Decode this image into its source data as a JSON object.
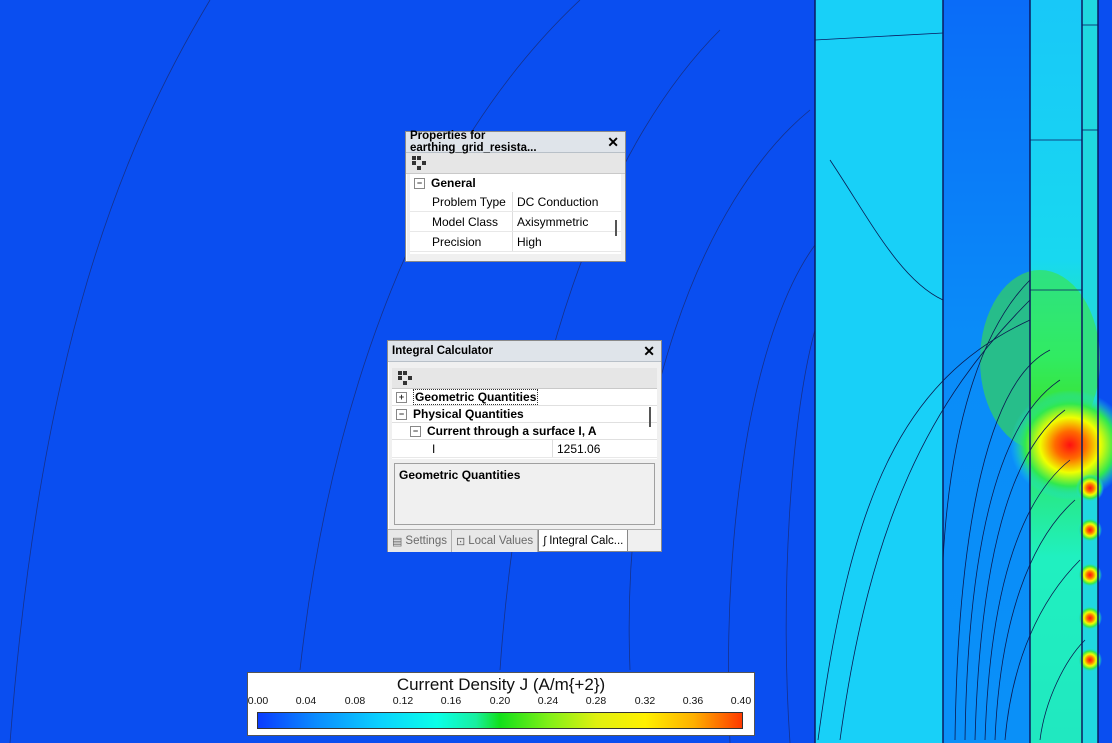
{
  "properties_window": {
    "title": "Properties for earthing_grid_resista...",
    "close_glyph": "✕",
    "group_label": "General",
    "rows": [
      {
        "key": "Problem Type",
        "value": "DC Conduction"
      },
      {
        "key": "Model Class",
        "value": "Axisymmetric"
      },
      {
        "key": "Precision",
        "value": "High"
      }
    ]
  },
  "integral_window": {
    "title": "Integral Calculator",
    "close_glyph": "✕",
    "groups": {
      "geometric": "Geometric Quantities",
      "physical": "Physical Quantities",
      "current": "Current through a surface I, A"
    },
    "value_row": {
      "key": "I",
      "value": "1251.06"
    },
    "description": "Geometric Quantities",
    "tabs": [
      {
        "label": "Settings",
        "active": false
      },
      {
        "label": "Local Values",
        "active": false
      },
      {
        "label": "Integral Calc...",
        "active": true
      }
    ]
  },
  "legend": {
    "title": "Current Density J (A/m{+2})",
    "ticks": [
      "0.00",
      "0.04",
      "0.08",
      "0.12",
      "0.16",
      "0.20",
      "0.24",
      "0.28",
      "0.32",
      "0.36",
      "0.40"
    ]
  },
  "colors": {
    "background": "#0a4ef0",
    "conductor": "#18d8f8",
    "hotspot": "#ff1a10"
  }
}
